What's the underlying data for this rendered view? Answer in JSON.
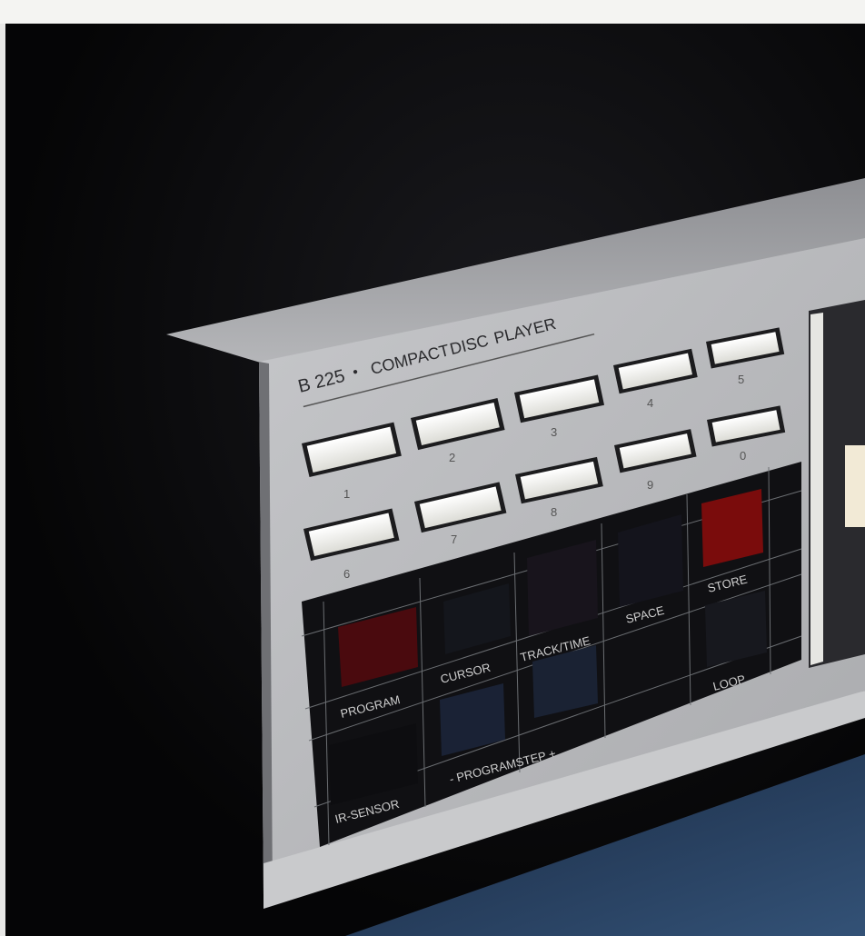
{
  "brand": {
    "model": "B 225",
    "separator": "•",
    "name_words": [
      "COMPACT",
      "DISC",
      "PLAYER"
    ]
  },
  "keys": {
    "row_top": [
      "3",
      "4",
      "5"
    ],
    "row_mid": [
      "1",
      "2",
      "8",
      "9",
      "0"
    ],
    "row_bottom": [
      "6",
      "7"
    ]
  },
  "controls": {
    "program": "PROGRAM",
    "cursor": "CURSOR",
    "track_time": "TRACK/TIME",
    "space": "SPACE",
    "store": "STORE",
    "loop": "LOOP",
    "program_step": "-  PROGRAMSTEP  +",
    "ir_sensor": "IR-SENSOR"
  },
  "colors": {
    "panel": "#b7b8bb",
    "key": "#eeeeea",
    "store_button": "#7a0c0c",
    "program_button": "#4a0a0e"
  }
}
